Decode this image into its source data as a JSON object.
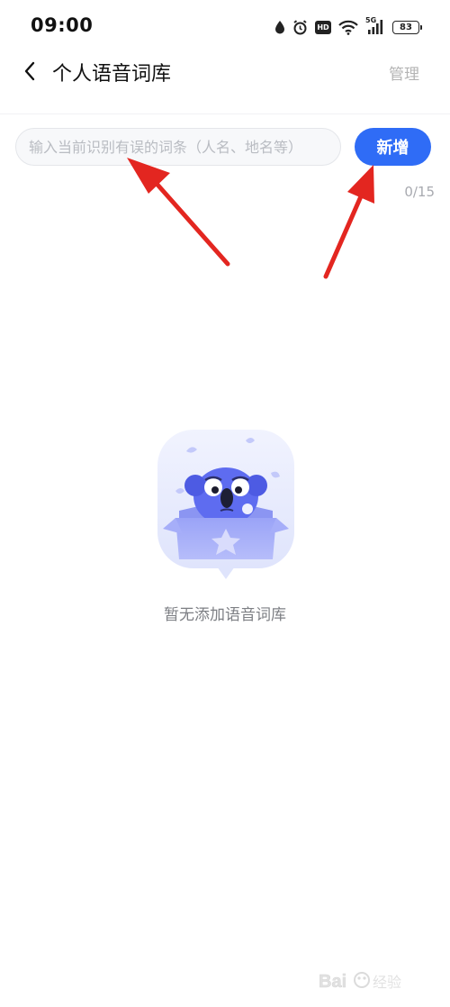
{
  "status_bar": {
    "time": "09:00",
    "hd_label": "HD",
    "network_label": "5G",
    "battery_level": "83"
  },
  "nav": {
    "title": "个人语音词库",
    "manage_label": "管理"
  },
  "entry": {
    "placeholder": "输入当前识别有误的词条（人名、地名等）",
    "value": "",
    "add_label": "新增",
    "counter": "0/15"
  },
  "empty_state": {
    "message": "暂无添加语音词库"
  },
  "watermark": {
    "text": "Bai 经验"
  },
  "colors": {
    "accent": "#2f6cf6",
    "annotation_arrow": "#e32620",
    "illustration_bg": "#e8ebfd",
    "mascot": "#5e6cf0"
  }
}
